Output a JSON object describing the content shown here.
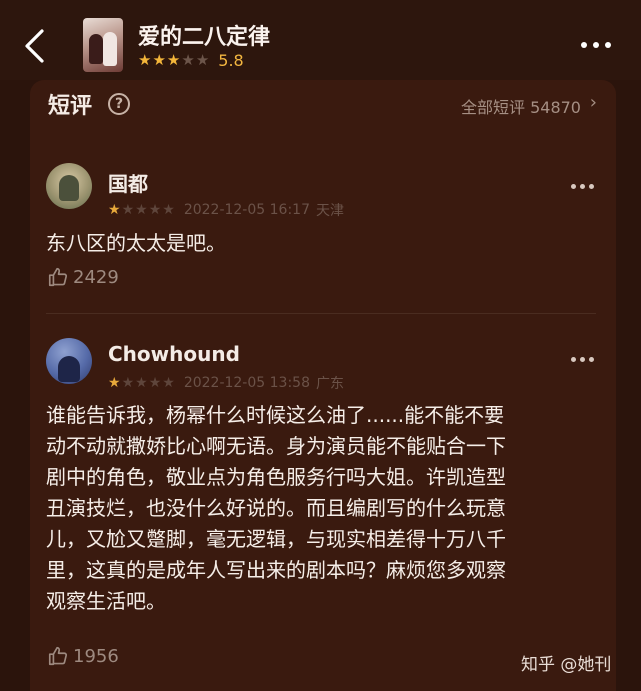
{
  "header": {
    "movie_title": "爱的二八定律",
    "rating_stars": 3,
    "rating_max": 5,
    "score": "5.8"
  },
  "section": {
    "title": "短评",
    "all_link": "全部短评 54870"
  },
  "reviews": [
    {
      "user": "国都",
      "stars": 1,
      "date": "2022-12-05 16:17",
      "location": "天津",
      "text": "东八区的太太是吧。",
      "likes": "2429"
    },
    {
      "user": "Chowhound",
      "stars": 1,
      "date": "2022-12-05 13:58",
      "location": "广东",
      "lines": [
        "谁能告诉我，杨幂什么时候这么油了......能不能不要",
        "动不动就撒娇比心啊无语。身为演员能不能贴合一下",
        "剧中的角色，敬业点为角色服务行吗大姐。许凯造型",
        "丑演技烂，也没什么好说的。而且编剧写的什么玩意",
        "儿，又尬又蹩脚，毫无逻辑，与现实相差得十万八千",
        "里，这真的是成年人写出来的剧本吗？麻烦您多观察",
        "观察生活吧。"
      ],
      "likes": "1956"
    }
  ],
  "watermark": "知乎 @她刊",
  "colors": {
    "background": "#2b140c",
    "card": "#3a1a0f",
    "star_on": "#f4b63a",
    "accent_score": "#f2b640"
  }
}
